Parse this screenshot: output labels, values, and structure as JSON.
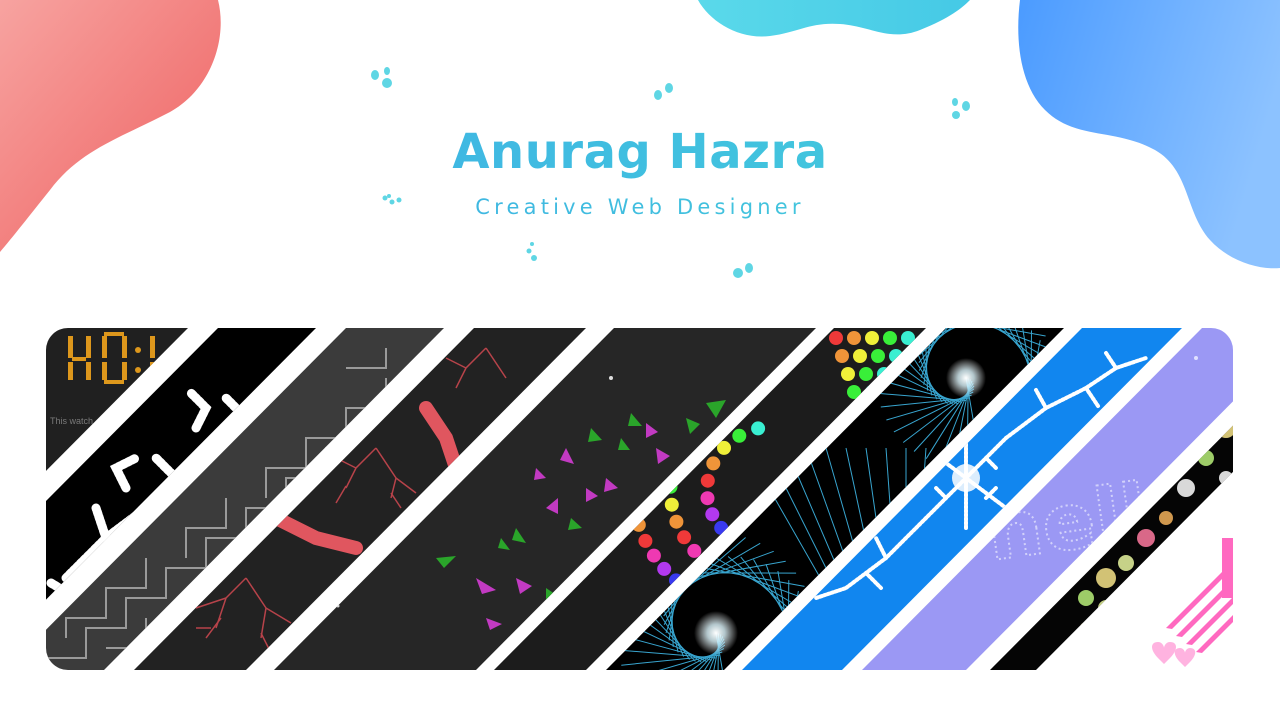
{
  "hero": {
    "name": "Anurag Hazra",
    "tagline": "Creative Web Designer"
  },
  "colors": {
    "accent_cyan": "#45d4d8",
    "accent_blue": "#3ca9e8",
    "blob_red": "#ee6565",
    "blob_blue": "#4fa3ff",
    "blob_cyan": "#4fd7e7",
    "strip_gap": "#ffffff"
  },
  "gallery": {
    "thumbnails": [
      {
        "name": "digital-clock-thumbnail",
        "theme": "dark",
        "caption": "This watch"
      },
      {
        "name": "fractal-tree-thumbnail",
        "theme": "black-white"
      },
      {
        "name": "maze-thumbnail",
        "theme": "gray"
      },
      {
        "name": "red-fractal-thumbnail",
        "theme": "dark-red"
      },
      {
        "name": "triangle-particles-thumbnail",
        "theme": "dark-magenta-green"
      },
      {
        "name": "rainbow-dots-spiral-thumbnail",
        "theme": "rainbow"
      },
      {
        "name": "string-art-spiral-thumbnail",
        "theme": "black-cyan"
      },
      {
        "name": "snowflake-fractal-thumbnail",
        "theme": "blue-white"
      },
      {
        "name": "particle-text-thumbnail",
        "theme": "lavender",
        "caption": "hello"
      },
      {
        "name": "glowing-particles-thumbnail",
        "theme": "black-glow"
      },
      {
        "name": "pink-hearts-thumbnail",
        "theme": "pink"
      }
    ]
  }
}
